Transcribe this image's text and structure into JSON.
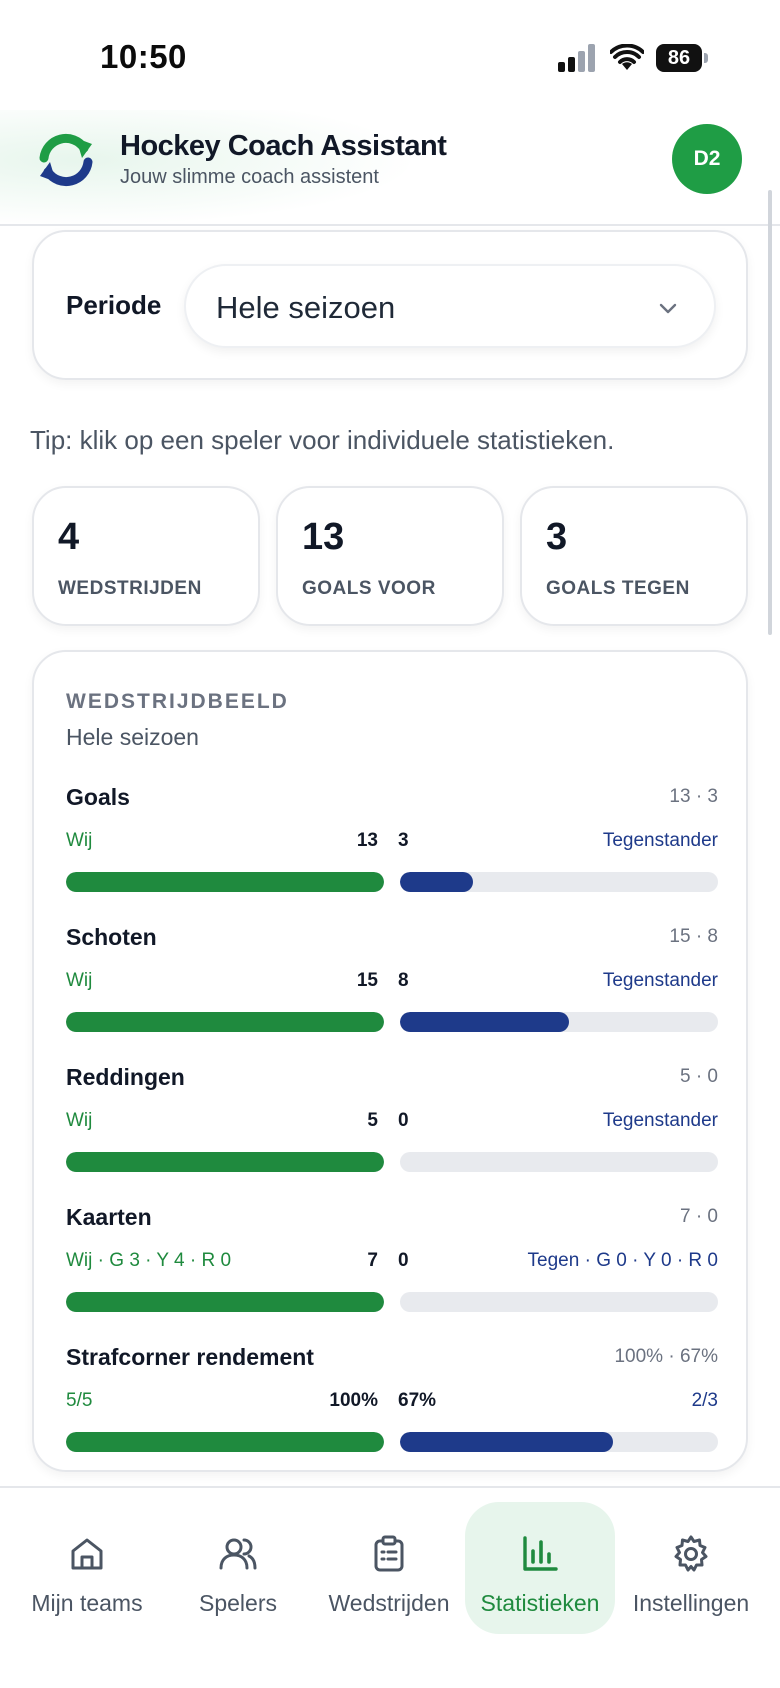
{
  "status_bar": {
    "time": "10:50",
    "battery": "86"
  },
  "header": {
    "title": "Hockey Coach Assistant",
    "subtitle": "Jouw slimme coach assistent",
    "avatar": "D2"
  },
  "period": {
    "label": "Periode",
    "value": "Hele seizoen"
  },
  "tip": "Tip: klik op een speler voor individuele statistieken.",
  "kpis": [
    {
      "value": "4",
      "label": "WEDSTRIJDEN"
    },
    {
      "value": "13",
      "label": "GOALS VOOR"
    },
    {
      "value": "3",
      "label": "GOALS TEGEN"
    }
  ],
  "game_picture": {
    "title": "WEDSTRIJDBEELD",
    "subtitle": "Hele seizoen",
    "stats": [
      {
        "name": "Goals",
        "summary": "13 · 3",
        "left_label": "Wij",
        "left_value": "13",
        "right_value": "3",
        "right_label": "Tegenstander",
        "left_fill": 1.0,
        "right_fill": 0.23
      },
      {
        "name": "Schoten",
        "summary": "15 · 8",
        "left_label": "Wij",
        "left_value": "15",
        "right_value": "8",
        "right_label": "Tegenstander",
        "left_fill": 1.0,
        "right_fill": 0.53
      },
      {
        "name": "Reddingen",
        "summary": "5 · 0",
        "left_label": "Wij",
        "left_value": "5",
        "right_value": "0",
        "right_label": "Tegenstander",
        "left_fill": 1.0,
        "right_fill": 0.0
      },
      {
        "name": "Kaarten",
        "summary": "7 · 0",
        "left_label": "Wij · G 3 · Y 4 · R 0",
        "left_value": "7",
        "right_value": "0",
        "right_label": "Tegen · G 0 · Y 0 · R 0",
        "left_fill": 1.0,
        "right_fill": 0.0
      },
      {
        "name": "Strafcorner rendement",
        "summary": "100% · 67%",
        "left_label": "5/5",
        "left_value": "100%",
        "right_value": "67%",
        "right_label": "2/3",
        "left_fill": 1.0,
        "right_fill": 0.67
      }
    ]
  },
  "nav": [
    {
      "label": "Mijn teams",
      "icon": "home-icon",
      "active": false
    },
    {
      "label": "Spelers",
      "icon": "users-icon",
      "active": false
    },
    {
      "label": "Wedstrijden",
      "icon": "clipboard-icon",
      "active": false
    },
    {
      "label": "Statistieken",
      "icon": "bar-chart-icon",
      "active": true
    },
    {
      "label": "Instellingen",
      "icon": "gear-icon",
      "active": false
    }
  ],
  "colors": {
    "green": "#1f8a3e",
    "navy": "#1e3a8a",
    "track": "#e8eaee"
  }
}
